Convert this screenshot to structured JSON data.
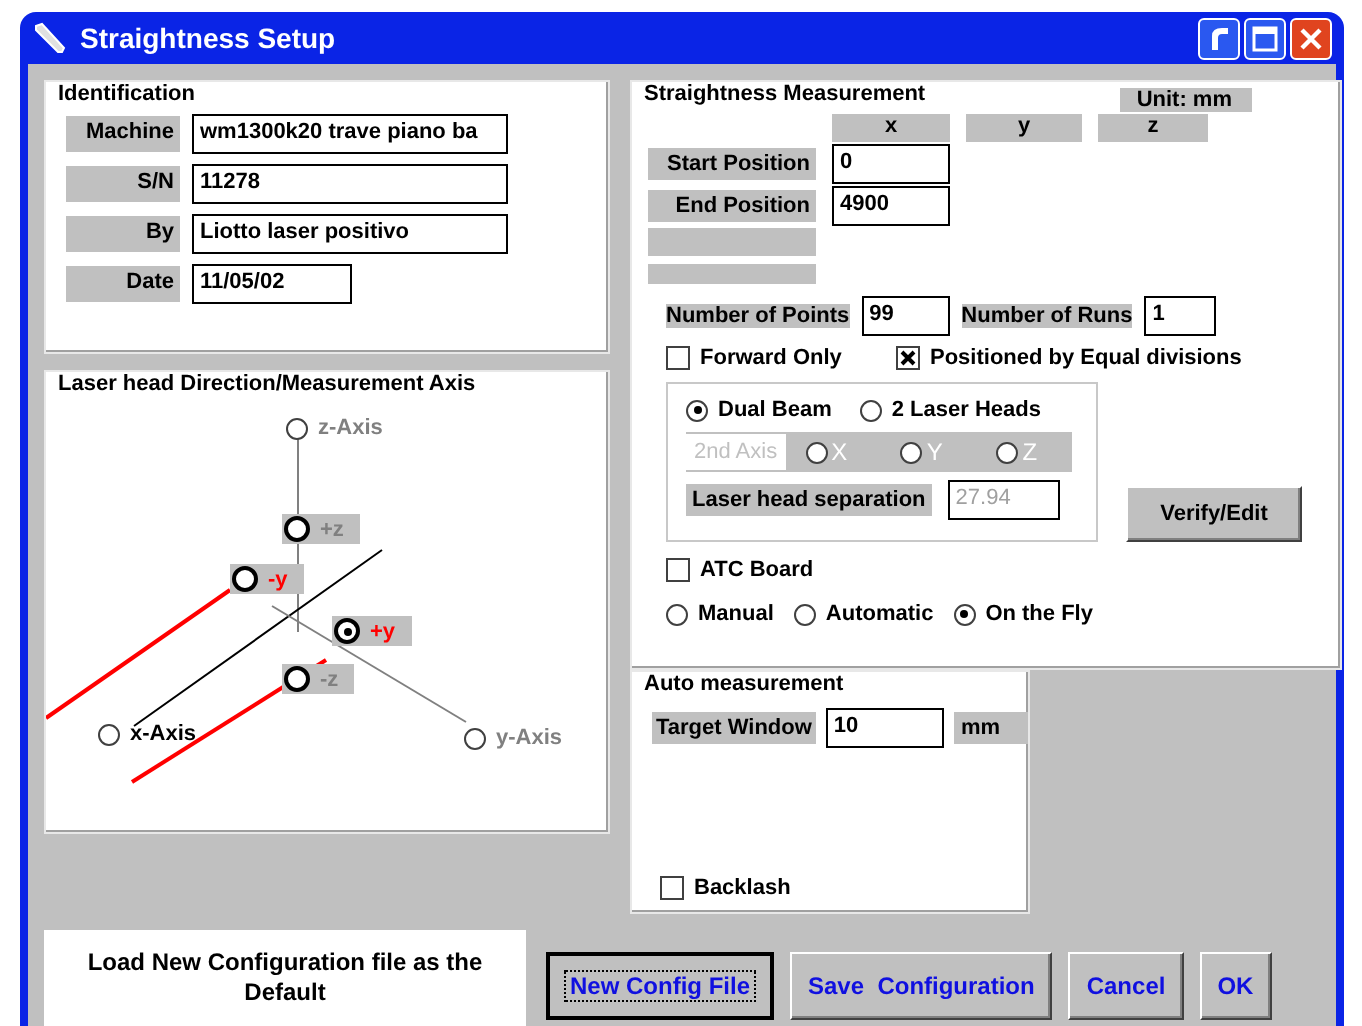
{
  "window": {
    "title": "Straightness Setup"
  },
  "identification": {
    "title": "Identification",
    "fields": [
      {
        "label": "Machine",
        "value": "wm1300k20 trave piano ba",
        "kind": "long"
      },
      {
        "label": "S/N",
        "value": "11278",
        "kind": "long"
      },
      {
        "label": "By",
        "value": "Liotto laser positivo",
        "kind": "long"
      },
      {
        "label": "Date",
        "value": "11/05/02",
        "kind": "short"
      }
    ]
  },
  "laser_head": {
    "title": "Laser head Direction/Measurement Axis",
    "options": [
      {
        "label": "z-Axis",
        "kind": "axis",
        "selected": false,
        "disabled": true
      },
      {
        "label": "+z",
        "kind": "direction",
        "selected": false,
        "color": "#808080"
      },
      {
        "label": "-y",
        "kind": "direction",
        "selected": false,
        "color": "#ff0000"
      },
      {
        "label": "+y",
        "kind": "direction",
        "selected": true,
        "color": "#ff0000"
      },
      {
        "label": "-z",
        "kind": "direction",
        "selected": false,
        "color": "#808080"
      },
      {
        "label": "x-Axis",
        "kind": "axis",
        "selected": false,
        "disabled": false
      },
      {
        "label": "y-Axis",
        "kind": "axis",
        "selected": false,
        "disabled": true
      }
    ]
  },
  "straightness": {
    "title": "Straightness Measurement",
    "unit": "Unit: mm",
    "columns": [
      "x",
      "y",
      "z"
    ],
    "positions": [
      {
        "label": "Start Position",
        "value": "0"
      },
      {
        "label": "End Position",
        "value": "4900"
      }
    ],
    "points": {
      "label": "Number of Points",
      "value": "99"
    },
    "runs": {
      "label": "Number of Runs",
      "value": "1"
    },
    "checkboxes": [
      {
        "label": "Forward Only",
        "checked": false
      },
      {
        "label": "Positioned by Equal divisions",
        "checked": true
      }
    ],
    "beam": {
      "options": [
        {
          "label": "Dual Beam",
          "selected": true
        },
        {
          "label": "2 Laser Heads",
          "selected": false
        }
      ],
      "second_axis": {
        "label": "2nd Axis",
        "options": [
          {
            "label": "X",
            "selected": false
          },
          {
            "label": "Y",
            "selected": false
          },
          {
            "label": "Z",
            "selected": false
          }
        ]
      },
      "separation": {
        "label": "Laser head separation",
        "value": "27.94",
        "disabled": true
      }
    },
    "verify_button": "Verify/Edit",
    "atc": {
      "label": "ATC Board",
      "checked": false
    },
    "modes": [
      {
        "label": "Manual",
        "selected": false
      },
      {
        "label": "Automatic",
        "selected": false
      },
      {
        "label": "On the Fly",
        "selected": true
      }
    ]
  },
  "auto_measurement": {
    "title": "Auto measurement",
    "target": {
      "label": "Target Window",
      "value": "10",
      "unit": "mm"
    },
    "backlash": {
      "label": "Backlash",
      "checked": false
    }
  },
  "load_note": "Load New Configuration file as the Default",
  "buttons": [
    {
      "label": "New Config File",
      "focused": true
    },
    {
      "label": "Save  Configuration",
      "focused": false
    },
    {
      "label": "Cancel",
      "focused": false
    },
    {
      "label": "OK",
      "focused": false
    }
  ]
}
